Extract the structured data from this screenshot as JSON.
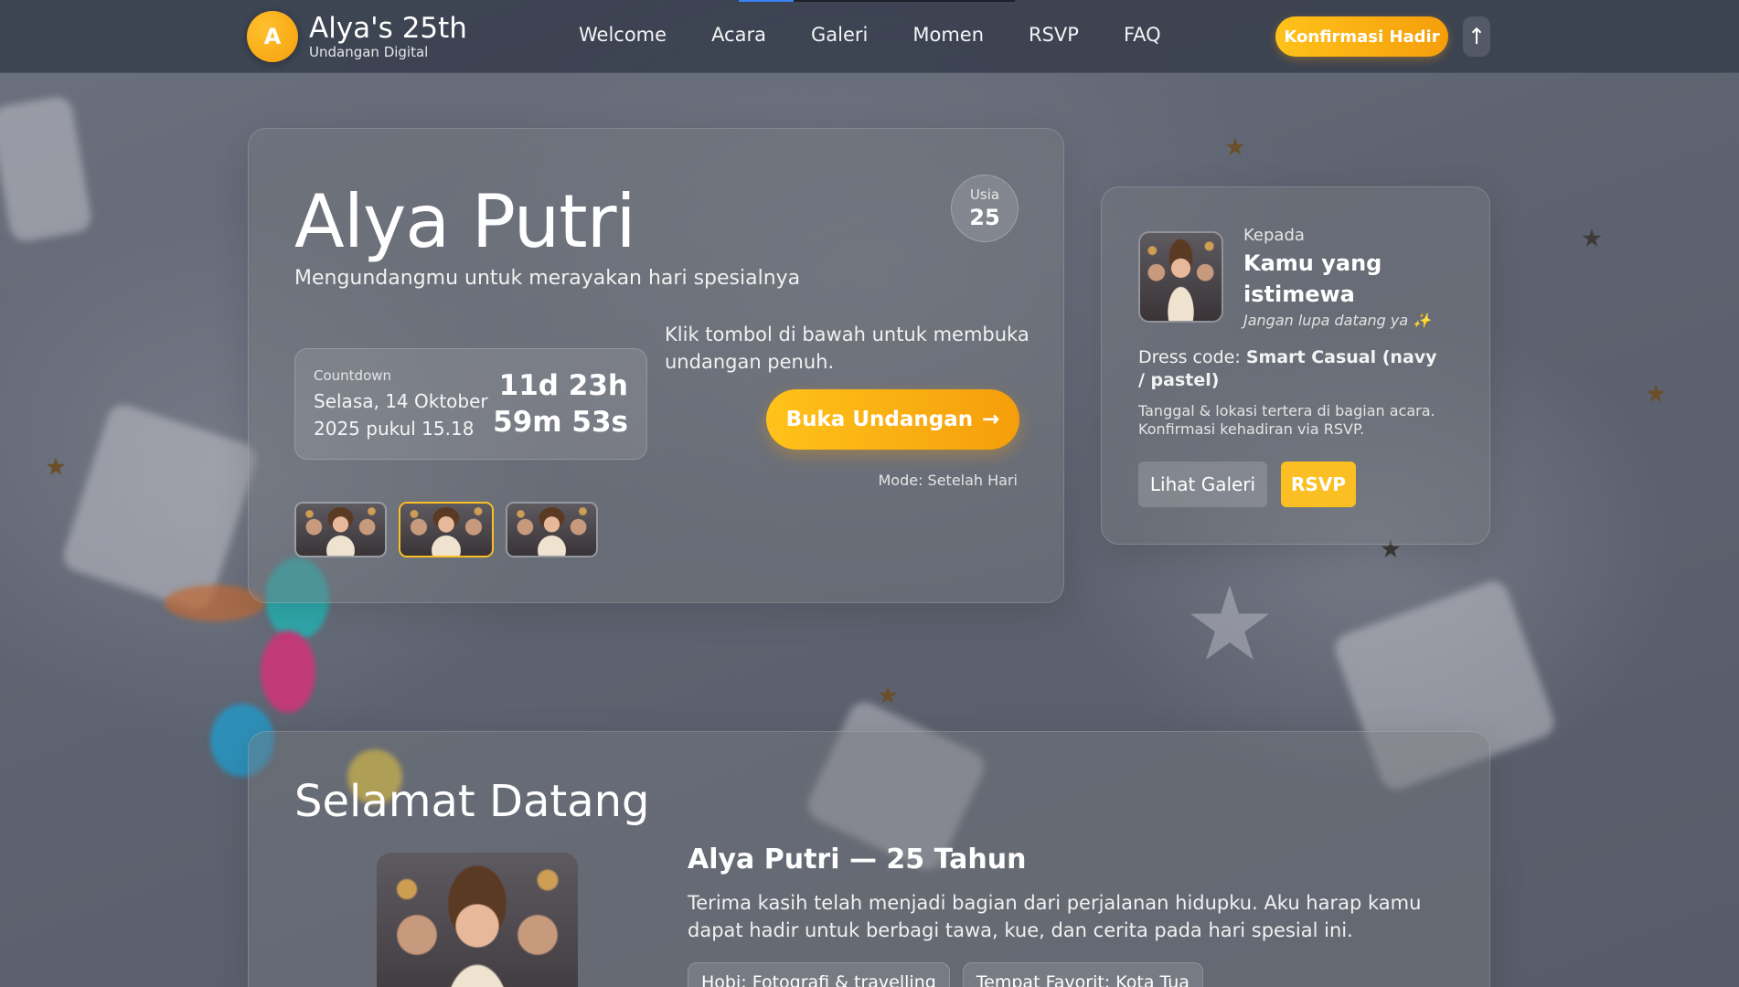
{
  "brand": {
    "logo_letter": "A",
    "title": "Alya's 25th",
    "subtitle": "Undangan Digital"
  },
  "nav": {
    "items": [
      "Welcome",
      "Acara",
      "Galeri",
      "Momen",
      "RSVP",
      "FAQ"
    ],
    "cta": "Konfirmasi Hadir",
    "up_icon": "↑"
  },
  "hero": {
    "name": "Alya Putri",
    "tagline": "Mengundangmu untuk merayakan hari spesialnya",
    "age_label": "Usia",
    "age_value": "25",
    "countdown_label": "Countdown",
    "countdown_date": "Selasa, 14 Oktober 2025 pukul 15.18",
    "countdown_line1": "11d 23h",
    "countdown_line2": "59m 53s",
    "hint": "Klik tombol di bawah untuk membuka undangan penuh.",
    "open_button": "Buka Undangan",
    "open_arrow": "→",
    "mode": "Mode: Setelah Hari"
  },
  "invite": {
    "to_label": "Kepada",
    "guest_name": "Kamu yang istimewa",
    "note": "Jangan lupa datang ya ✨",
    "dress_label": "Dress code:",
    "dress_value": "Smart Casual (navy / pastel)",
    "info": "Tanggal & lokasi tertera di bagian acara. Konfirmasi kehadiran via RSVP.",
    "gallery_button": "Lihat Galeri",
    "rsvp_button": "RSVP"
  },
  "welcome": {
    "title": "Selamat Datang",
    "heading": "Alya Putri — 25 Tahun",
    "body": "Terima kasih telah menjadi bagian dari perjalanan hidupku. Aku harap kamu dapat hadir untuk berbagi tawa, kue, dan cerita pada hari spesial ini.",
    "chips": [
      "Hobi: Fotografi & travelling",
      "Tempat Favorit: Kota Tua"
    ]
  },
  "colors": {
    "accent": "#fbbf24",
    "accent_dark": "#f59e0b",
    "nav_bg": "#3a404e"
  }
}
